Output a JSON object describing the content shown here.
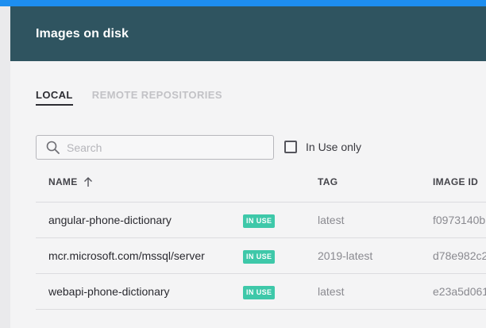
{
  "header": {
    "title": "Images on disk"
  },
  "tabs": [
    {
      "label": "LOCAL",
      "active": true
    },
    {
      "label": "REMOTE REPOSITORIES",
      "active": false
    }
  ],
  "search": {
    "placeholder": "Search",
    "value": ""
  },
  "filter": {
    "label": "In Use only",
    "checked": false
  },
  "table": {
    "columns": {
      "name": "NAME",
      "tag": "TAG",
      "image_id": "IMAGE ID"
    },
    "sort": {
      "column": "NAME",
      "direction": "ascending",
      "icon": "arrow-up-icon"
    },
    "rows": [
      {
        "name": "angular-phone-dictionary",
        "badge": "IN USE",
        "tag": "latest",
        "image_id": "f0973140b"
      },
      {
        "name": "mcr.microsoft.com/mssql/server",
        "badge": "IN USE",
        "tag": "2019-latest",
        "image_id": "d78e982c2"
      },
      {
        "name": "webapi-phone-dictionary",
        "badge": "IN USE",
        "tag": "latest",
        "image_id": "e23a5d061"
      }
    ]
  },
  "colors": {
    "accent_bar": "#1d8ef0",
    "header_bg": "#2f5460",
    "badge_bg": "#3ec8a9"
  }
}
